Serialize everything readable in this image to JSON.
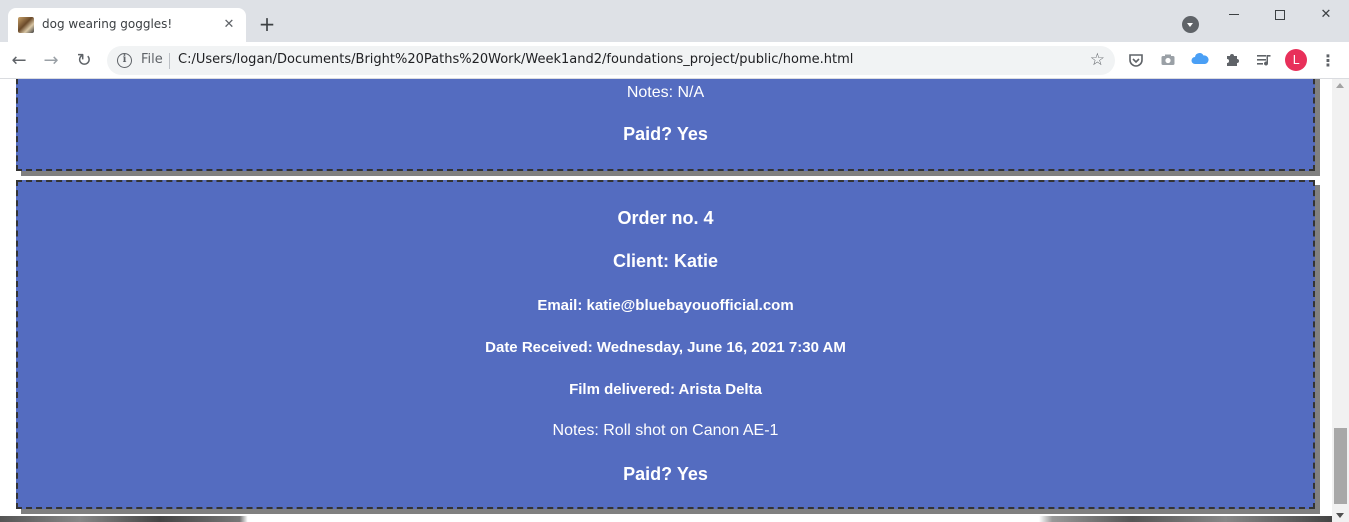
{
  "browser": {
    "tab": {
      "title": "dog wearing goggles!",
      "close_icon": "close-icon"
    },
    "new_tab_label": "+",
    "window_controls": {
      "close_glyph": "✕"
    },
    "toolbar": {
      "back_glyph": "←",
      "forward_glyph": "→",
      "reload_glyph": "↻",
      "info_glyph": "i",
      "scheme_label": "File",
      "url": "C:/Users/logan/Documents/Bright%20Paths%20Work/Week1and2/foundations_project/public/home.html",
      "star_glyph": "☆",
      "profile_initial": "L",
      "profile_color": "#e8305a",
      "menu_glyph": "⋮"
    }
  },
  "page": {
    "accent_color": "#546cc0",
    "previous_order": {
      "notes": "Notes: N/A",
      "paid": "Paid? Yes"
    },
    "order": {
      "heading": "Order no. 4",
      "client": "Client: Katie",
      "email": "Email: katie@bluebayouofficial.com",
      "date_received": "Date Received: Wednesday, June 16, 2021 7:30 AM",
      "film_delivered": "Film delivered: Arista Delta",
      "notes": "Notes: Roll shot on Canon AE-1",
      "paid": "Paid? Yes"
    }
  }
}
